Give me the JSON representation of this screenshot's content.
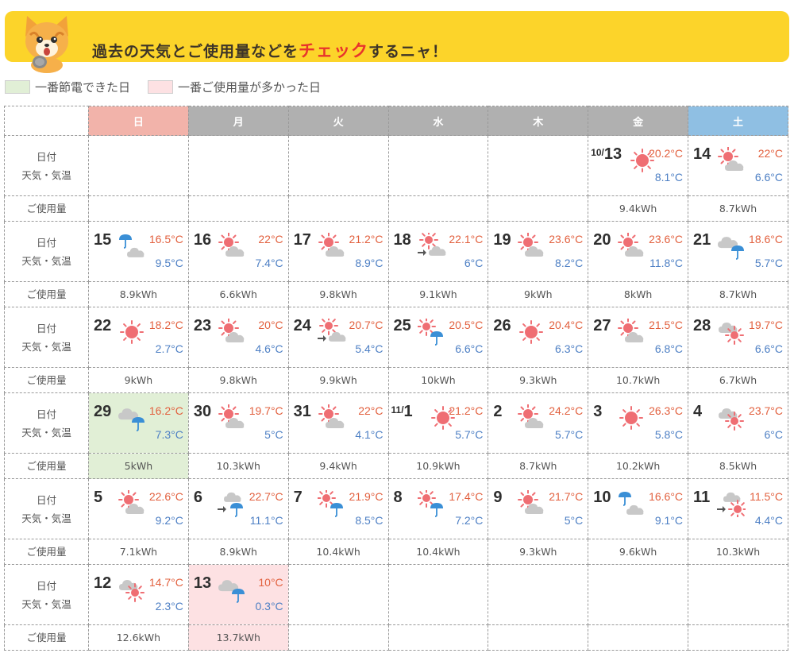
{
  "banner": {
    "text_a": "過去の天気とご使用量などを",
    "text_b": "チェック",
    "text_c": "するニャ！"
  },
  "legend": {
    "green_label": "一番節電できた日",
    "pink_label": "一番ご使用量が多かった日"
  },
  "labels": {
    "date": "日付",
    "weather": "天気・気温",
    "usage": "ご使用量"
  },
  "weekdays": [
    "日",
    "月",
    "火",
    "水",
    "木",
    "金",
    "土"
  ],
  "colors": {
    "banner": "#fcd42a",
    "sun_header": "#f2b3aa",
    "sat_header": "#8fbfe3",
    "weekday_header": "#b0b0b0",
    "least_usage": "#e1efd6",
    "most_usage": "#fde1e3",
    "high_temp": "#e2603e",
    "low_temp": "#4d7fc4"
  },
  "weeks": [
    {
      "days": [
        null,
        null,
        null,
        null,
        null,
        {
          "mon": "10/",
          "date": "13",
          "icon": "sun-icon",
          "hi": "20.2°C",
          "lo": "8.1°C",
          "kwh": "9.4kWh"
        },
        {
          "date": "14",
          "icon": "sun-cloud-icon",
          "hi": "22°C",
          "lo": "6.6°C",
          "kwh": "8.7kWh"
        }
      ]
    },
    {
      "days": [
        {
          "date": "15",
          "icon": "rain-cloud-icon",
          "hi": "16.5°C",
          "lo": "9.5°C",
          "kwh": "8.9kWh"
        },
        {
          "date": "16",
          "icon": "sun-cloud-icon",
          "hi": "22°C",
          "lo": "7.4°C",
          "kwh": "6.6kWh"
        },
        {
          "date": "17",
          "icon": "sun-cloud-icon",
          "hi": "21.2°C",
          "lo": "8.9°C",
          "kwh": "9.8kWh"
        },
        {
          "date": "18",
          "icon": "sun-then-cloud-icon",
          "hi": "22.1°C",
          "lo": "6°C",
          "kwh": "9.1kWh"
        },
        {
          "date": "19",
          "icon": "sun-cloud-icon",
          "hi": "23.6°C",
          "lo": "8.2°C",
          "kwh": "9kWh"
        },
        {
          "date": "20",
          "icon": "sun-cloud-icon",
          "hi": "23.6°C",
          "lo": "11.8°C",
          "kwh": "8kWh"
        },
        {
          "date": "21",
          "icon": "cloud-rain-icon",
          "hi": "18.6°C",
          "lo": "5.7°C",
          "kwh": "8.7kWh"
        }
      ]
    },
    {
      "days": [
        {
          "date": "22",
          "icon": "sun-icon",
          "hi": "18.2°C",
          "lo": "2.7°C",
          "kwh": "9kWh"
        },
        {
          "date": "23",
          "icon": "sun-cloud-icon",
          "hi": "20°C",
          "lo": "4.6°C",
          "kwh": "9.8kWh"
        },
        {
          "date": "24",
          "icon": "sun-then-cloud-icon",
          "hi": "20.7°C",
          "lo": "5.4°C",
          "kwh": "9.9kWh"
        },
        {
          "date": "25",
          "icon": "sun-rain-icon",
          "hi": "20.5°C",
          "lo": "6.6°C",
          "kwh": "10kWh"
        },
        {
          "date": "26",
          "icon": "sun-icon",
          "hi": "20.4°C",
          "lo": "6.3°C",
          "kwh": "9.3kWh"
        },
        {
          "date": "27",
          "icon": "sun-cloud-icon",
          "hi": "21.5°C",
          "lo": "6.8°C",
          "kwh": "10.7kWh"
        },
        {
          "date": "28",
          "icon": "cloud-sun-icon",
          "hi": "19.7°C",
          "lo": "6.6°C",
          "kwh": "6.7kWh"
        }
      ]
    },
    {
      "days": [
        {
          "date": "29",
          "icon": "cloud-rain-icon",
          "hi": "16.2°C",
          "lo": "7.3°C",
          "kwh": "5kWh",
          "hl": "green"
        },
        {
          "date": "30",
          "icon": "sun-cloud-icon",
          "hi": "19.7°C",
          "lo": "5°C",
          "kwh": "10.3kWh"
        },
        {
          "date": "31",
          "icon": "sun-cloud-icon",
          "hi": "22°C",
          "lo": "4.1°C",
          "kwh": "9.4kWh"
        },
        {
          "mon": "11/",
          "date": "1",
          "icon": "sun-icon",
          "hi": "21.2°C",
          "lo": "5.7°C",
          "kwh": "10.9kWh"
        },
        {
          "date": "2",
          "icon": "sun-cloud-icon",
          "hi": "24.2°C",
          "lo": "5.7°C",
          "kwh": "8.7kWh"
        },
        {
          "date": "3",
          "icon": "sun-icon",
          "hi": "26.3°C",
          "lo": "5.8°C",
          "kwh": "10.2kWh"
        },
        {
          "date": "4",
          "icon": "cloud-sun-icon",
          "hi": "23.7°C",
          "lo": "6°C",
          "kwh": "8.5kWh"
        }
      ]
    },
    {
      "days": [
        {
          "date": "5",
          "icon": "sun-cloud-icon",
          "hi": "22.6°C",
          "lo": "9.2°C",
          "kwh": "7.1kWh"
        },
        {
          "date": "6",
          "icon": "cloud-then-rain-icon",
          "hi": "22.7°C",
          "lo": "11.1°C",
          "kwh": "8.9kWh"
        },
        {
          "date": "7",
          "icon": "sun-rain-icon",
          "hi": "21.9°C",
          "lo": "8.5°C",
          "kwh": "10.4kWh"
        },
        {
          "date": "8",
          "icon": "sun-rain-icon",
          "hi": "17.4°C",
          "lo": "7.2°C",
          "kwh": "10.4kWh"
        },
        {
          "date": "9",
          "icon": "sun-cloud-icon",
          "hi": "21.7°C",
          "lo": "5°C",
          "kwh": "9.3kWh"
        },
        {
          "date": "10",
          "icon": "rain-cloud-icon",
          "hi": "16.6°C",
          "lo": "9.1°C",
          "kwh": "9.6kWh"
        },
        {
          "date": "11",
          "icon": "cloud-then-sun-icon",
          "hi": "11.5°C",
          "lo": "4.4°C",
          "kwh": "10.3kWh"
        }
      ]
    },
    {
      "days": [
        {
          "date": "12",
          "icon": "cloud-sun-icon",
          "hi": "14.7°C",
          "lo": "2.3°C",
          "kwh": "12.6kWh"
        },
        {
          "date": "13",
          "icon": "cloud-rain-icon",
          "hi": "10°C",
          "lo": "0.3°C",
          "kwh": "13.7kWh",
          "hl": "pink"
        },
        null,
        null,
        null,
        null,
        null
      ]
    }
  ]
}
